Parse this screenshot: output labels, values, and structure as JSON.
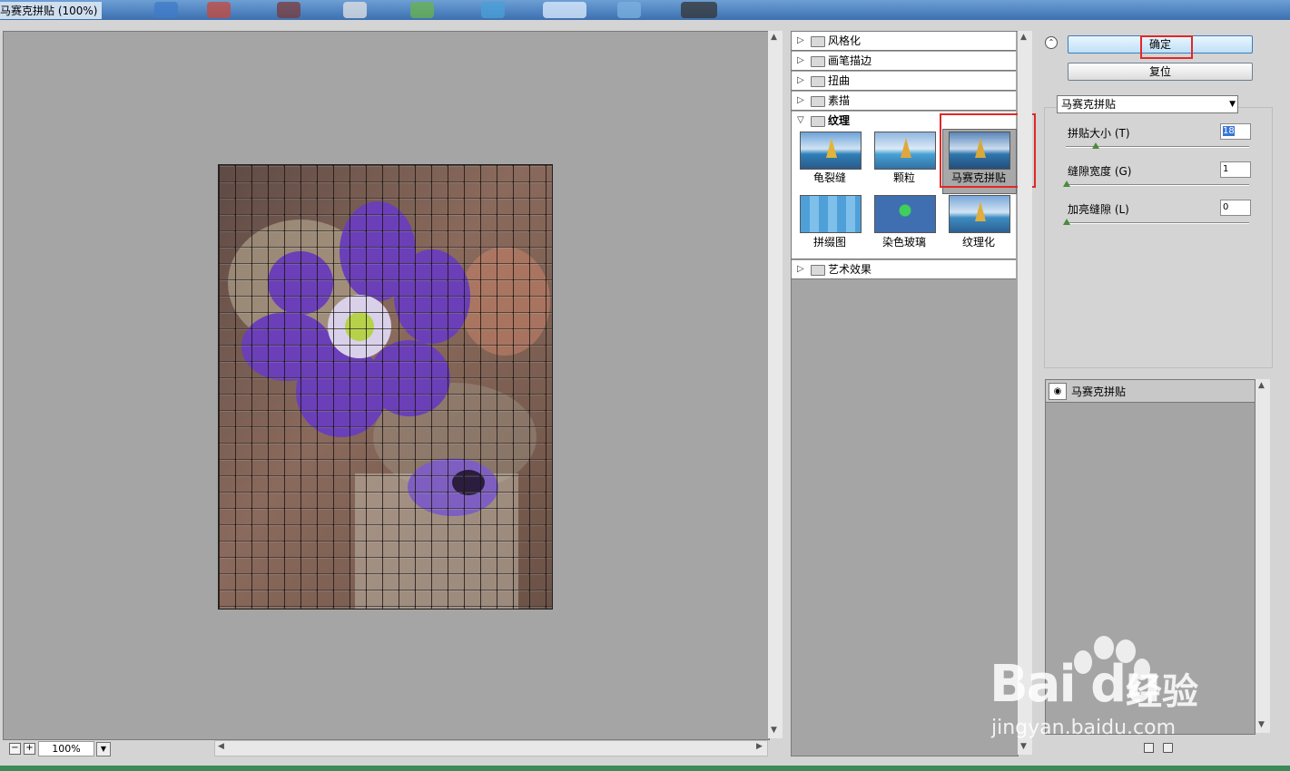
{
  "window": {
    "title": "马赛克拼贴 (100%)"
  },
  "preview": {
    "zoom": "100%"
  },
  "gallery": {
    "categories": [
      {
        "label": "风格化",
        "expanded": false
      },
      {
        "label": "画笔描边",
        "expanded": false
      },
      {
        "label": "扭曲",
        "expanded": false
      },
      {
        "label": "素描",
        "expanded": false
      },
      {
        "label": "纹理",
        "expanded": true
      },
      {
        "label": "艺术效果",
        "expanded": false
      }
    ],
    "texture_filters": [
      {
        "label": "龟裂缝"
      },
      {
        "label": "颗粒"
      },
      {
        "label": "马赛克拼贴",
        "selected": true
      },
      {
        "label": "拼缀图"
      },
      {
        "label": "染色玻璃"
      },
      {
        "label": "纹理化"
      }
    ]
  },
  "buttons": {
    "ok": "确定",
    "reset": "复位"
  },
  "filter_select": {
    "value": "马赛克拼贴"
  },
  "params": [
    {
      "label": "拼贴大小 (T)",
      "value": "18",
      "level": 0.18
    },
    {
      "label": "缝隙宽度 (G)",
      "value": "1",
      "level": 0.0
    },
    {
      "label": "加亮缝隙 (L)",
      "value": "0",
      "level": 0.0
    }
  ],
  "layers": {
    "items": [
      {
        "name": "马赛克拼贴"
      }
    ]
  },
  "watermark": {
    "brand": "Bai du",
    "cn": "经验",
    "url": "jingyan.baidu.com"
  },
  "colors": {
    "selection_highlight": "#e02828",
    "ok_button": "#bfe0f7",
    "flower": "#6a3fb8"
  }
}
